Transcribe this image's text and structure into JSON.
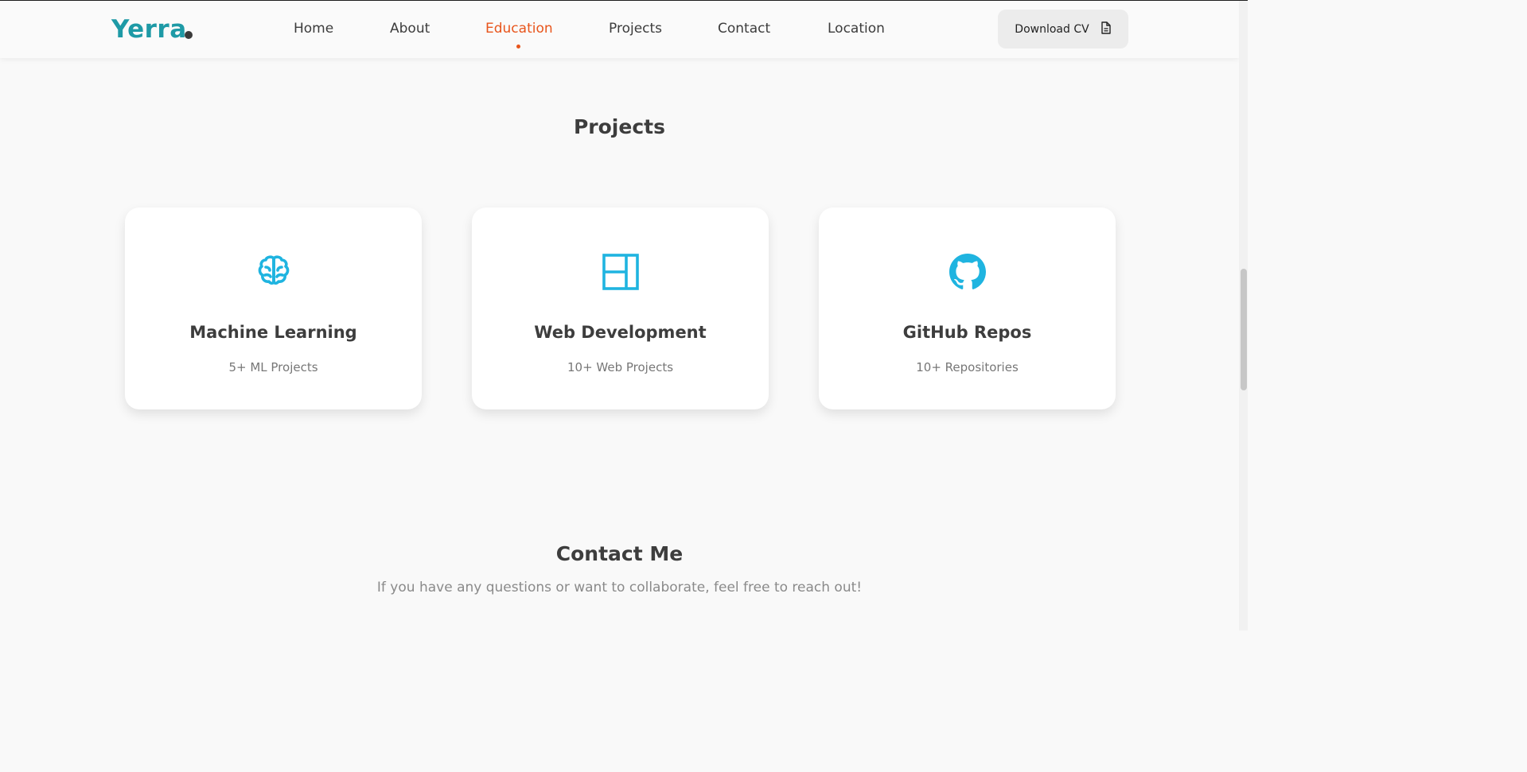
{
  "navbar": {
    "logo_text": "Yerra",
    "items": [
      {
        "label": "Home"
      },
      {
        "label": "About"
      },
      {
        "label": "Education",
        "active": true
      },
      {
        "label": "Projects"
      },
      {
        "label": "Contact"
      },
      {
        "label": "Location"
      }
    ],
    "cv_button": {
      "label": "Download CV",
      "icon": "document-icon"
    }
  },
  "projects": {
    "title": "Projects",
    "cards": [
      {
        "icon": "brain-icon",
        "title": "Machine Learning",
        "subtitle": "5+ ML Projects"
      },
      {
        "icon": "layout-icon",
        "title": "Web Development",
        "subtitle": "10+ Web Projects"
      },
      {
        "icon": "github-icon",
        "title": "GitHub Repos",
        "subtitle": "10+ Repositories"
      }
    ]
  },
  "contact": {
    "title": "Contact Me",
    "subtitle": "If you have any questions or want to collaborate, feel free to reach out!"
  },
  "colors": {
    "brand": "#1e9aa6",
    "active_nav": "#e8551c",
    "icon": "#1fb4e0"
  }
}
